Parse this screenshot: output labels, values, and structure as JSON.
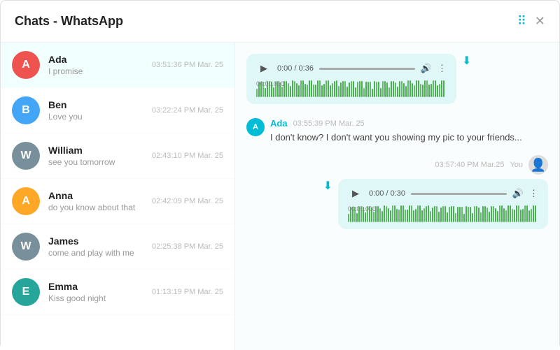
{
  "header": {
    "title": "Chats - WhatsApp"
  },
  "sidebar": {
    "chats": [
      {
        "id": "ada",
        "name": "Ada",
        "preview": "I promise",
        "time": "03:51:36 PM Mar. 25",
        "avatar_color": "#ef5350",
        "avatar_letter": "A",
        "active": true
      },
      {
        "id": "ben",
        "name": "Ben",
        "preview": "Love you",
        "time": "03:22:24 PM Mar. 25",
        "avatar_color": "#42a5f5",
        "avatar_letter": "B",
        "active": false
      },
      {
        "id": "william",
        "name": "William",
        "preview": "see you tomorrow",
        "time": "02:43:10 PM Mar. 25",
        "avatar_color": "#78909c",
        "avatar_letter": "W",
        "active": false
      },
      {
        "id": "anna",
        "name": "Anna",
        "preview": "do you know about that",
        "time": "02:42:09 PM Mar. 25",
        "avatar_color": "#ffa726",
        "avatar_letter": "A",
        "active": false
      },
      {
        "id": "james",
        "name": "James",
        "preview": "come and play with me",
        "time": "02:25:38 PM Mar. 25",
        "avatar_color": "#78909c",
        "avatar_letter": "W",
        "active": false
      },
      {
        "id": "emma",
        "name": "Emma",
        "preview": "Kiss good night",
        "time": "01:13:19 PM Mar. 25",
        "avatar_color": "#26a69a",
        "avatar_letter": "E",
        "active": false
      }
    ]
  },
  "chat": {
    "incoming_audio": {
      "time_display": "0:00 / 0:36",
      "waveform_time": "00:00.000"
    },
    "message": {
      "sender": "Ada",
      "sender_initial": "A",
      "time": "03:55:39 PM Mar. 25",
      "text": "I don't know? I don't want you showing my pic to your friends..."
    },
    "outgoing_audio": {
      "time_label": "03:57:40 PM Mar.25",
      "you_label": "You",
      "time_display": "0:00 / 0:30",
      "waveform_time": "00:00.000"
    }
  },
  "icons": {
    "grid_icon": "⠿",
    "close_icon": "✕",
    "play_icon": "▶",
    "volume_icon": "🔊",
    "more_icon": "⋮",
    "download_icon": "⬇",
    "user_icon": "👤"
  }
}
